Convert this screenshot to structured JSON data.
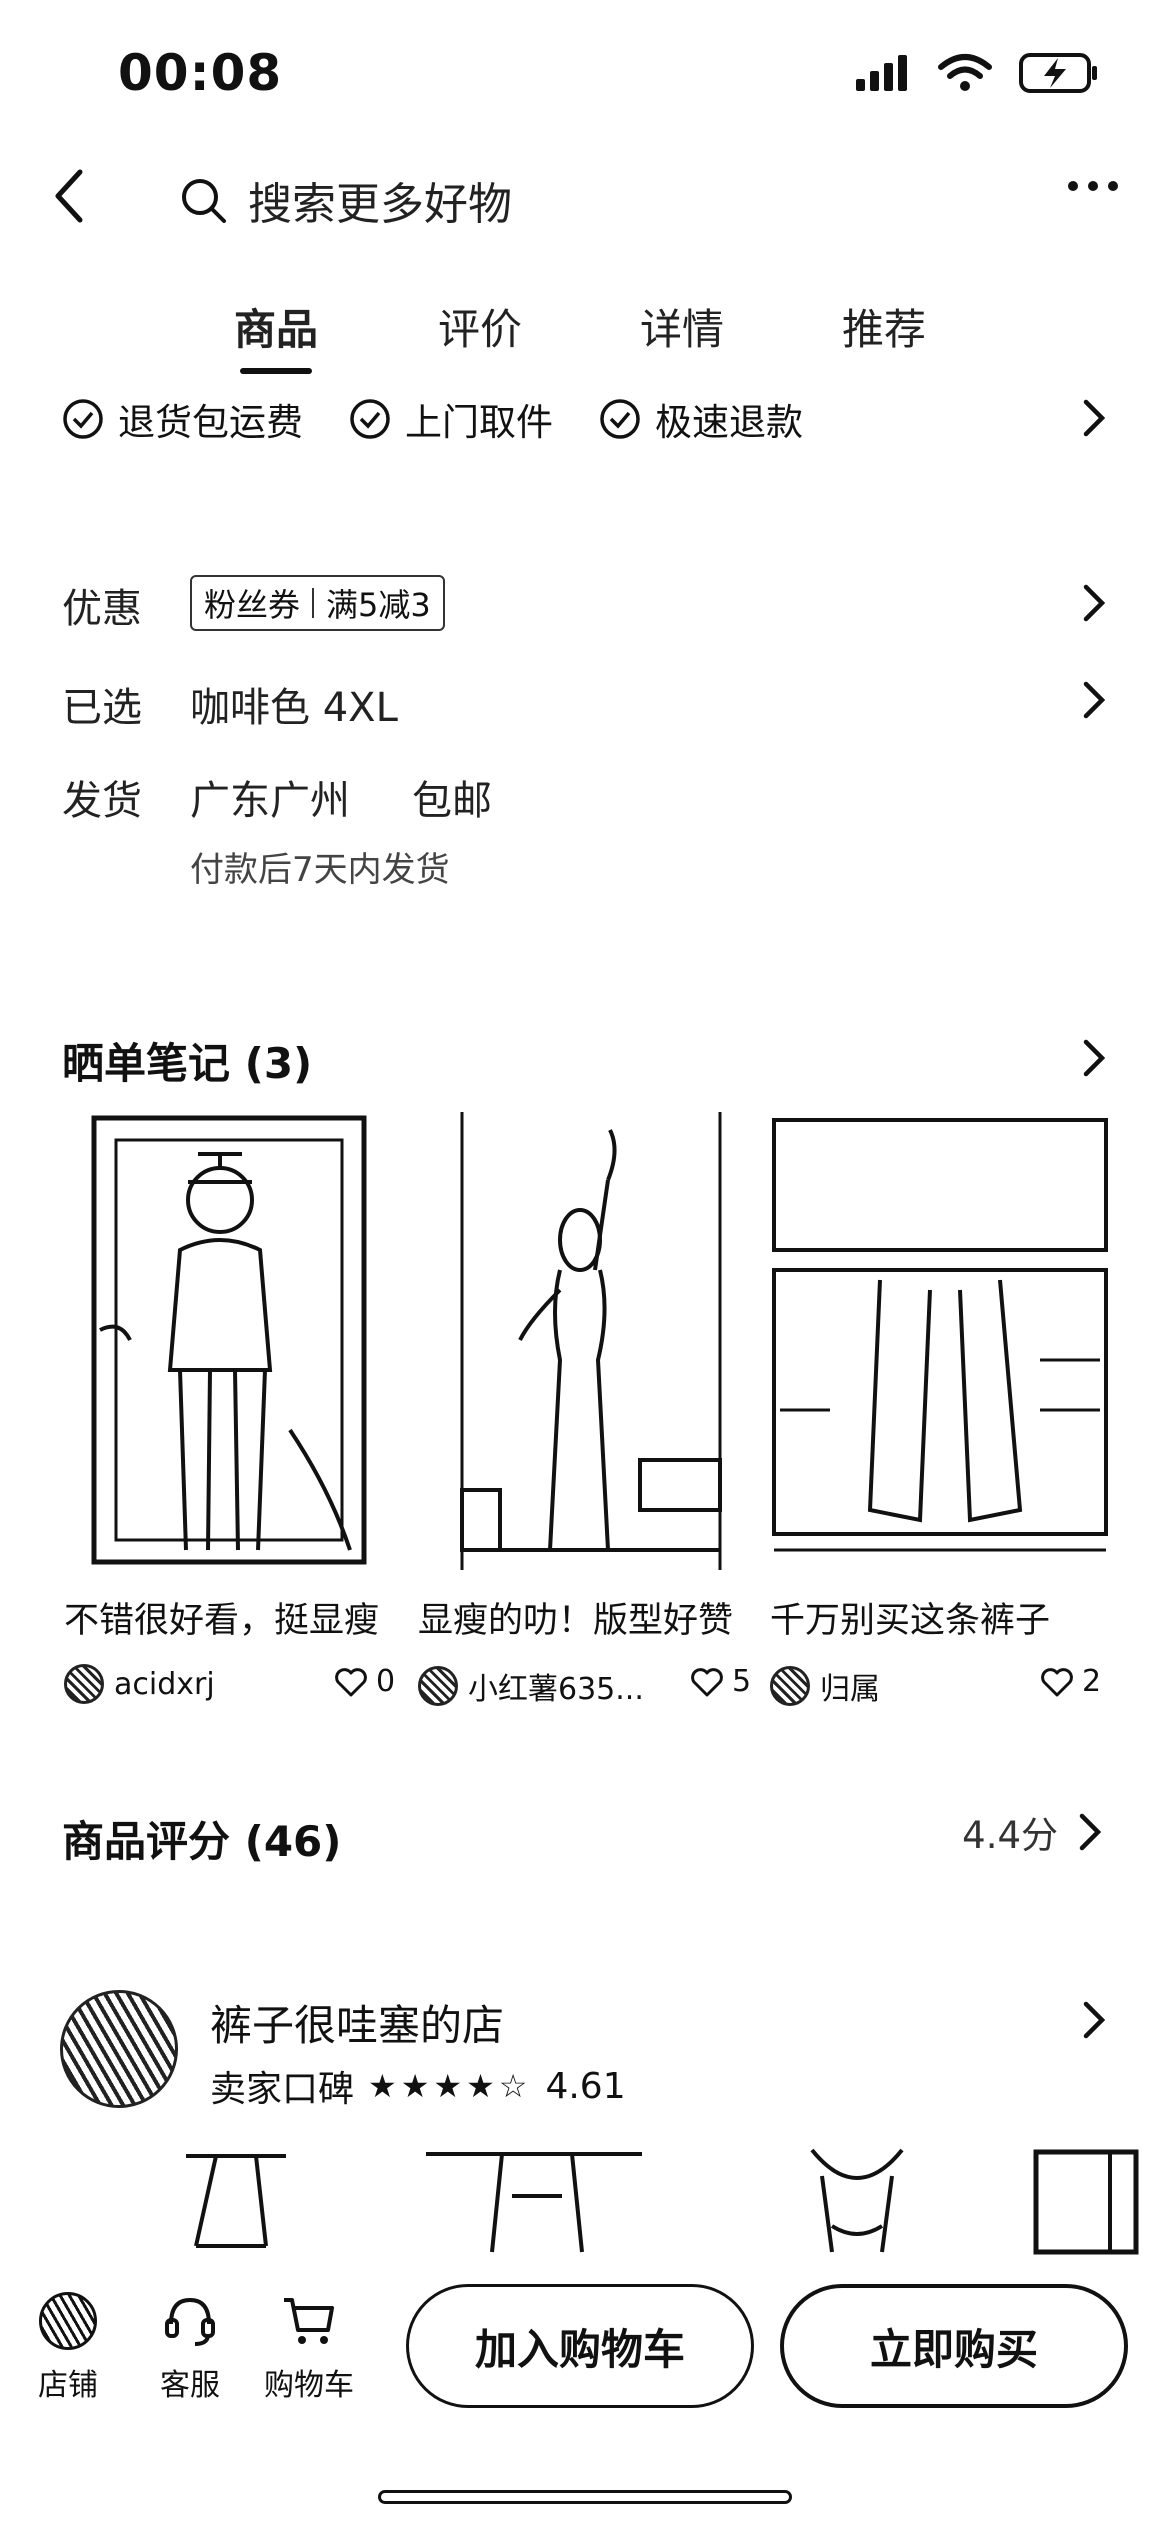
{
  "status": {
    "time": "00:08"
  },
  "nav": {
    "search_placeholder": "搜索更多好物"
  },
  "tabs": [
    "商品",
    "评价",
    "详情",
    "推荐"
  ],
  "services": [
    "退货包运费",
    "上门取件",
    "极速退款"
  ],
  "promo": {
    "label": "优惠",
    "coupon_left": "粉丝券",
    "coupon_right": "满5减3"
  },
  "selected": {
    "label": "已选",
    "value": "咖啡色 4XL"
  },
  "shipping": {
    "label": "发货",
    "origin": "广东广州",
    "fee": "包邮",
    "note": "付款后7天内发货"
  },
  "notes": {
    "title": "晒单笔记 (3)",
    "items": [
      {
        "caption": "不错很好看，挺显瘦",
        "user": "acidxrj",
        "likes": "0"
      },
      {
        "caption": "显瘦的叻！版型好赞",
        "user": "小红薯635...",
        "likes": "5"
      },
      {
        "caption": "千万别买这条裤子",
        "user": "归属",
        "likes": "2"
      }
    ]
  },
  "rating": {
    "title": "商品评分 (46)",
    "score": "4.4分"
  },
  "shop": {
    "name": "裤子很哇塞的店",
    "rep_label": "卖家口碑",
    "stars": "★★★★☆",
    "score": "4.61"
  },
  "bottom": {
    "store": "店铺",
    "service": "客服",
    "cart": "购物车",
    "add_cart": "加入购物车",
    "buy_now": "立即购买"
  }
}
